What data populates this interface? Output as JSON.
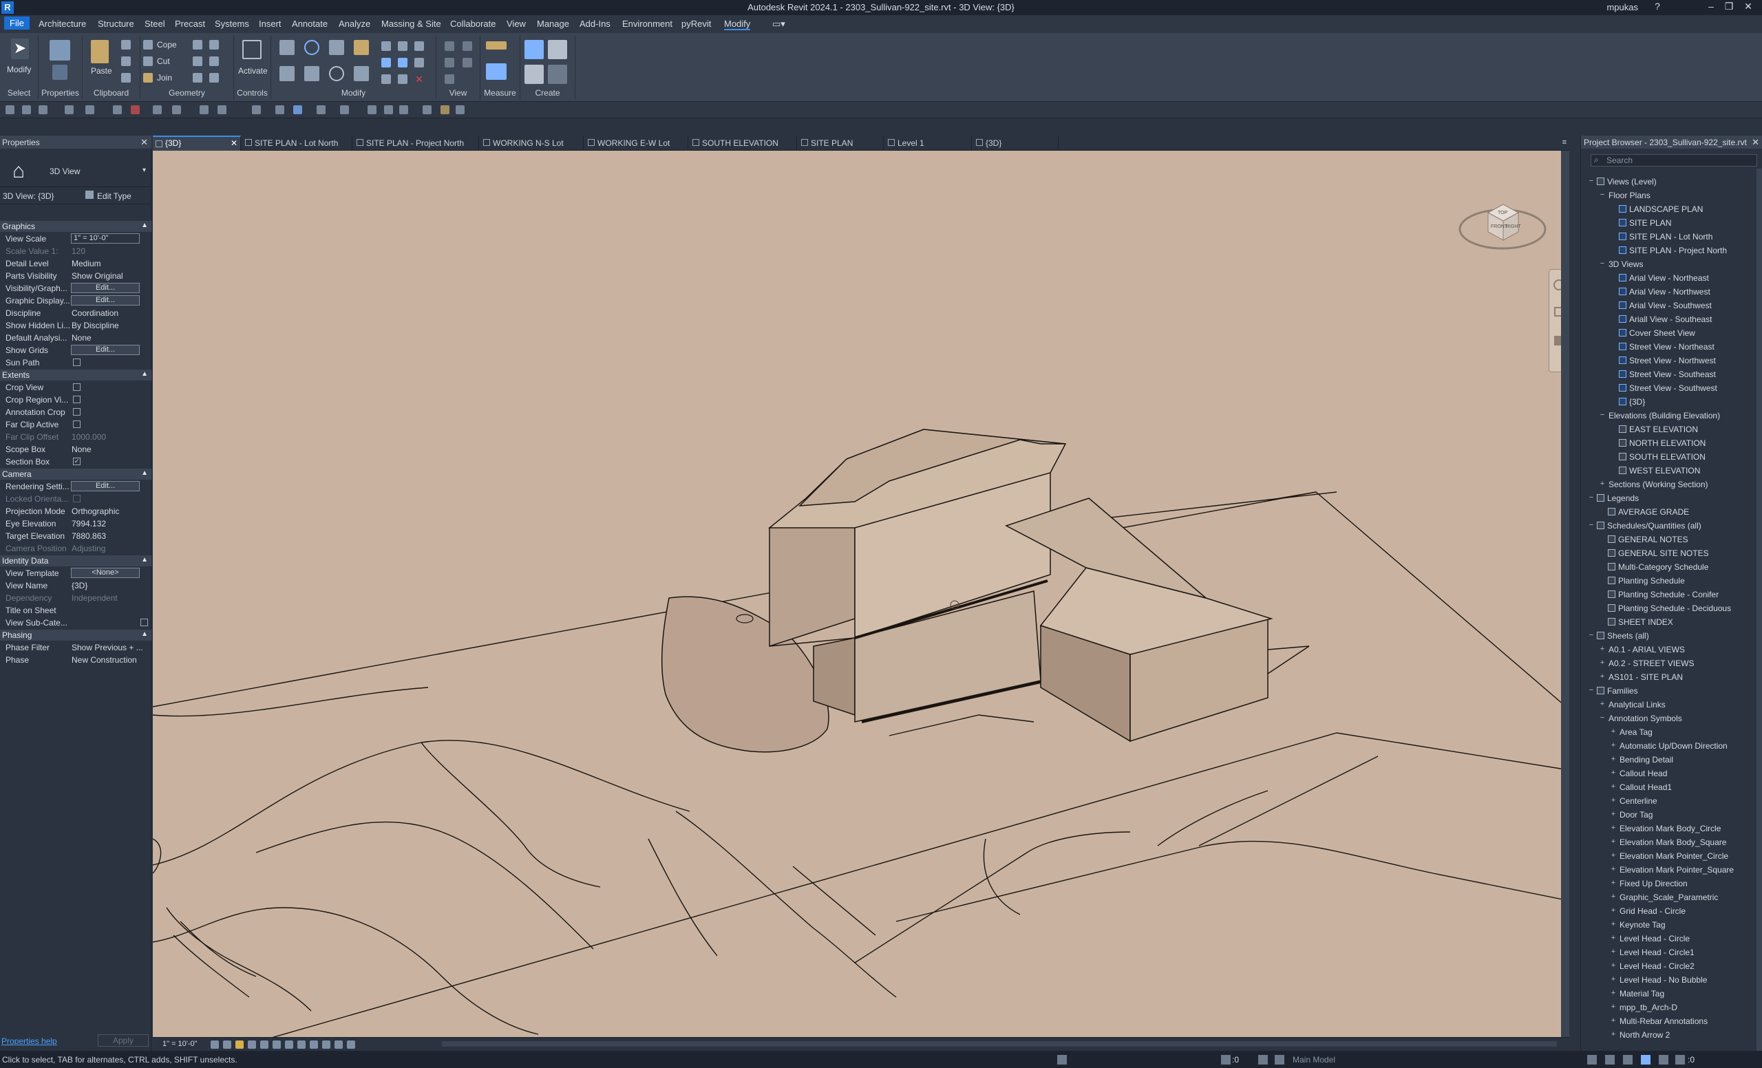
{
  "titlebar": {
    "title": "Autodesk Revit 2024.1 - 2303_Sullivan-922_site.rvt - 3D View: {3D}",
    "user": "mpukas",
    "logo": "R"
  },
  "menu": [
    "File",
    "Architecture",
    "Structure",
    "Steel",
    "Precast",
    "Systems",
    "Insert",
    "Annotate",
    "Analyze",
    "Massing & Site",
    "Collaborate",
    "View",
    "Manage",
    "Add-Ins",
    "Environment",
    "pyRevit",
    "Modify"
  ],
  "ribbon": {
    "modify_label": "Modify",
    "paste_label": "Paste",
    "cope_label": "Cope",
    "cut_label": "Cut",
    "join_label": "Join",
    "activate_label": "Activate",
    "groups": [
      "Select",
      "Properties",
      "Clipboard",
      "Geometry",
      "Controls",
      "Modify",
      "View",
      "Measure",
      "Create"
    ]
  },
  "properties": {
    "title": "Properties",
    "type_name": "3D View",
    "instance_selector": "3D View: {3D}",
    "edit_type": "Edit Type",
    "sections": {
      "graphics": "Graphics",
      "extents": "Extents",
      "camera": "Camera",
      "identity": "Identity Data",
      "phasing": "Phasing"
    },
    "graphics": [
      {
        "k": "View Scale",
        "v": "1\" = 10'-0\""
      },
      {
        "k": "Scale Value    1:",
        "v": "120"
      },
      {
        "k": "Detail Level",
        "v": "Medium"
      },
      {
        "k": "Parts Visibility",
        "v": "Show Original"
      },
      {
        "k": "Visibility/Graph...",
        "v": "Edit..."
      },
      {
        "k": "Graphic Display...",
        "v": "Edit..."
      },
      {
        "k": "Discipline",
        "v": "Coordination"
      },
      {
        "k": "Show Hidden Li...",
        "v": "By Discipline"
      },
      {
        "k": "Default Analysi...",
        "v": "None"
      },
      {
        "k": "Show Grids",
        "v": "Edit..."
      },
      {
        "k": "Sun Path",
        "v": ""
      }
    ],
    "extents": [
      {
        "k": "Crop View",
        "v": ""
      },
      {
        "k": "Crop Region Vi...",
        "v": ""
      },
      {
        "k": "Annotation Crop",
        "v": ""
      },
      {
        "k": "Far Clip Active",
        "v": ""
      },
      {
        "k": "Far Clip Offset",
        "v": "1000.000"
      },
      {
        "k": "Scope Box",
        "v": "None"
      },
      {
        "k": "Section Box",
        "v": "✓"
      }
    ],
    "camera": [
      {
        "k": "Rendering Setti...",
        "v": "Edit..."
      },
      {
        "k": "Locked Orienta...",
        "v": ""
      },
      {
        "k": "Projection Mode",
        "v": "Orthographic"
      },
      {
        "k": "Eye Elevation",
        "v": "7994.132"
      },
      {
        "k": "Target Elevation",
        "v": "7880.863"
      },
      {
        "k": "Camera Position",
        "v": "Adjusting"
      }
    ],
    "identity": [
      {
        "k": "View Template",
        "v": "<None>"
      },
      {
        "k": "View Name",
        "v": "{3D}"
      },
      {
        "k": "Dependency",
        "v": "Independent"
      },
      {
        "k": "Title on Sheet",
        "v": ""
      },
      {
        "k": "View Sub-Cate...",
        "v": ""
      }
    ],
    "phasing": [
      {
        "k": "Phase Filter",
        "v": "Show Previous + ..."
      },
      {
        "k": "Phase",
        "v": "New Construction"
      }
    ],
    "help": "Properties help",
    "apply": "Apply"
  },
  "tabs": [
    "{3D}",
    "SITE PLAN - Lot North",
    "SITE PLAN - Project North",
    "WORKING N-S Lot",
    "WORKING E-W Lot",
    "SOUTH ELEVATION",
    "SITE PLAN",
    "Level 1",
    "{3D}"
  ],
  "viewcube": {
    "front": "FRONT",
    "right": "RIGHT",
    "top": "TOP"
  },
  "viewcontrol": {
    "scale": "1\" = 10'-0\""
  },
  "status": {
    "message": "Click to select, TAB for alternates, CTRL adds, SHIFT unselects.",
    "model": "Main Model",
    "zero_a": ":0",
    "zero_b": ":0"
  },
  "browser": {
    "title": "Project Browser - 2303_Sullivan-922_site.rvt",
    "search_placeholder": "Search",
    "tree": [
      {
        "l": 0,
        "e": "−",
        "t": "Views (Level)",
        "i": "box"
      },
      {
        "l": 1,
        "e": "−",
        "t": "Floor Plans",
        "i": ""
      },
      {
        "l": 2,
        "e": "",
        "t": "LANDSCAPE PLAN",
        "i": "plan"
      },
      {
        "l": 2,
        "e": "",
        "t": "SITE PLAN",
        "i": "plan"
      },
      {
        "l": 2,
        "e": "",
        "t": "SITE PLAN - Lot North",
        "i": "plan"
      },
      {
        "l": 2,
        "e": "",
        "t": "SITE PLAN - Project North",
        "i": "plan"
      },
      {
        "l": 1,
        "e": "−",
        "t": "3D Views",
        "i": ""
      },
      {
        "l": 2,
        "e": "",
        "t": "Arial View - Northeast",
        "i": "plan"
      },
      {
        "l": 2,
        "e": "",
        "t": "Arial View - Northwest",
        "i": "plan"
      },
      {
        "l": 2,
        "e": "",
        "t": "Arial View - Southwest",
        "i": "plan"
      },
      {
        "l": 2,
        "e": "",
        "t": "Ariall View - Southeast",
        "i": "plan"
      },
      {
        "l": 2,
        "e": "",
        "t": "Cover Sheet View",
        "i": "plan"
      },
      {
        "l": 2,
        "e": "",
        "t": "Street View - Northeast",
        "i": "plan"
      },
      {
        "l": 2,
        "e": "",
        "t": "Street View - Northwest",
        "i": "plan"
      },
      {
        "l": 2,
        "e": "",
        "t": "Street View - Southeast",
        "i": "plan"
      },
      {
        "l": 2,
        "e": "",
        "t": "Street View - Southwest",
        "i": "plan"
      },
      {
        "l": 2,
        "e": "",
        "t": "{3D}",
        "i": "plan"
      },
      {
        "l": 1,
        "e": "−",
        "t": "Elevations (Building Elevation)",
        "i": ""
      },
      {
        "l": 2,
        "e": "",
        "t": "EAST ELEVATION",
        "i": "box"
      },
      {
        "l": 2,
        "e": "",
        "t": "NORTH ELEVATION",
        "i": "box"
      },
      {
        "l": 2,
        "e": "",
        "t": "SOUTH ELEVATION",
        "i": "box"
      },
      {
        "l": 2,
        "e": "",
        "t": "WEST ELEVATION",
        "i": "box"
      },
      {
        "l": 1,
        "e": "+",
        "t": "Sections (Working Section)",
        "i": ""
      },
      {
        "l": 0,
        "e": "−",
        "t": "Legends",
        "i": "box"
      },
      {
        "l": 1,
        "e": "",
        "t": "AVERAGE GRADE",
        "i": "box"
      },
      {
        "l": 0,
        "e": "−",
        "t": "Schedules/Quantities (all)",
        "i": "box"
      },
      {
        "l": 1,
        "e": "",
        "t": "GENERAL NOTES",
        "i": "box"
      },
      {
        "l": 1,
        "e": "",
        "t": "GENERAL SITE NOTES",
        "i": "box"
      },
      {
        "l": 1,
        "e": "",
        "t": "Multi-Category Schedule",
        "i": "box"
      },
      {
        "l": 1,
        "e": "",
        "t": "Planting Schedule",
        "i": "box"
      },
      {
        "l": 1,
        "e": "",
        "t": "Planting Schedule - Conifer",
        "i": "box"
      },
      {
        "l": 1,
        "e": "",
        "t": "Planting Schedule - Deciduous",
        "i": "box"
      },
      {
        "l": 1,
        "e": "",
        "t": "SHEET INDEX",
        "i": "box"
      },
      {
        "l": 0,
        "e": "−",
        "t": "Sheets (all)",
        "i": "box"
      },
      {
        "l": 1,
        "e": "+",
        "t": "A0.1 - ARIAL VIEWS",
        "i": ""
      },
      {
        "l": 1,
        "e": "+",
        "t": "A0.2 - STREET VIEWS",
        "i": ""
      },
      {
        "l": 1,
        "e": "+",
        "t": "AS101 - SITE PLAN",
        "i": ""
      },
      {
        "l": 0,
        "e": "−",
        "t": "Families",
        "i": "box"
      },
      {
        "l": 1,
        "e": "+",
        "t": "Analytical Links",
        "i": ""
      },
      {
        "l": 1,
        "e": "−",
        "t": "Annotation Symbols",
        "i": ""
      },
      {
        "l": 2,
        "e": "+",
        "t": "Area Tag",
        "i": ""
      },
      {
        "l": 2,
        "e": "+",
        "t": "Automatic Up/Down Direction",
        "i": ""
      },
      {
        "l": 2,
        "e": "+",
        "t": "Bending Detail",
        "i": ""
      },
      {
        "l": 2,
        "e": "+",
        "t": "Callout Head",
        "i": ""
      },
      {
        "l": 2,
        "e": "+",
        "t": "Callout Head1",
        "i": ""
      },
      {
        "l": 2,
        "e": "+",
        "t": "Centerline",
        "i": ""
      },
      {
        "l": 2,
        "e": "+",
        "t": "Door Tag",
        "i": ""
      },
      {
        "l": 2,
        "e": "+",
        "t": "Elevation Mark Body_Circle",
        "i": ""
      },
      {
        "l": 2,
        "e": "+",
        "t": "Elevation Mark Body_Square",
        "i": ""
      },
      {
        "l": 2,
        "e": "+",
        "t": "Elevation Mark Pointer_Circle",
        "i": ""
      },
      {
        "l": 2,
        "e": "+",
        "t": "Elevation Mark Pointer_Square",
        "i": ""
      },
      {
        "l": 2,
        "e": "+",
        "t": "Fixed Up Direction",
        "i": ""
      },
      {
        "l": 2,
        "e": "+",
        "t": "Graphic_Scale_Parametric",
        "i": ""
      },
      {
        "l": 2,
        "e": "+",
        "t": "Grid Head - Circle",
        "i": ""
      },
      {
        "l": 2,
        "e": "+",
        "t": "Keynote Tag",
        "i": ""
      },
      {
        "l": 2,
        "e": "+",
        "t": "Level Head - Circle",
        "i": ""
      },
      {
        "l": 2,
        "e": "+",
        "t": "Level Head - Circle1",
        "i": ""
      },
      {
        "l": 2,
        "e": "+",
        "t": "Level Head - Circle2",
        "i": ""
      },
      {
        "l": 2,
        "e": "+",
        "t": "Level Head - No Bubble",
        "i": ""
      },
      {
        "l": 2,
        "e": "+",
        "t": "Material Tag",
        "i": ""
      },
      {
        "l": 2,
        "e": "+",
        "t": "mpp_tb_Arch-D",
        "i": ""
      },
      {
        "l": 2,
        "e": "+",
        "t": "Multi-Rebar Annotations",
        "i": ""
      },
      {
        "l": 2,
        "e": "+",
        "t": "North Arrow 2",
        "i": ""
      }
    ]
  },
  "colors": {
    "accent": "#1a6fd6",
    "viewport_bg": "#c9b3a0",
    "panel_bg": "#2b3340",
    "ribbon_bg": "#3b4453"
  }
}
